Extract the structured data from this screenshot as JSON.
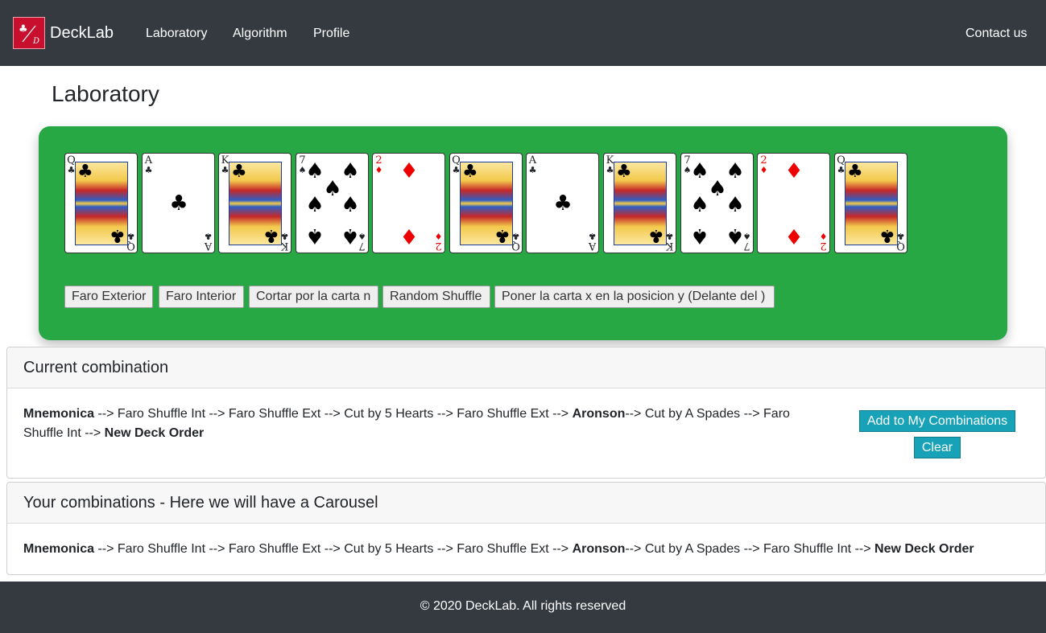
{
  "nav": {
    "brand": "DeckLab",
    "links": [
      "Laboratory",
      "Algorithm",
      "Profile"
    ],
    "contact": "Contact us"
  },
  "page": {
    "title": "Laboratory"
  },
  "cards": [
    {
      "rank": "Q",
      "suit": "♣",
      "color": "black",
      "kind": "face"
    },
    {
      "rank": "A",
      "suit": "♣",
      "color": "black",
      "kind": "ace"
    },
    {
      "rank": "K",
      "suit": "♣",
      "color": "black",
      "kind": "face"
    },
    {
      "rank": "7",
      "suit": "♠",
      "color": "black",
      "kind": "seven"
    },
    {
      "rank": "2",
      "suit": "♦",
      "color": "red",
      "kind": "two"
    },
    {
      "rank": "Q",
      "suit": "♣",
      "color": "black",
      "kind": "face"
    },
    {
      "rank": "A",
      "suit": "♣",
      "color": "black",
      "kind": "ace"
    },
    {
      "rank": "K",
      "suit": "♣",
      "color": "black",
      "kind": "face"
    },
    {
      "rank": "7",
      "suit": "♠",
      "color": "black",
      "kind": "seven"
    },
    {
      "rank": "2",
      "suit": "♦",
      "color": "red",
      "kind": "two"
    },
    {
      "rank": "Q",
      "suit": "♣",
      "color": "black",
      "kind": "face"
    }
  ],
  "operations": [
    "Faro Exterior",
    "Faro Interior",
    "Cortar por la carta n",
    "Random Shuffle",
    "Poner la carta x en la posicion y (Delante del )"
  ],
  "current": {
    "header": "Current combination",
    "start": "Mnemonica",
    "steps_a": " --> Faro Shuffle Int --> Faro Shuffle Ext --> Cut by 5 Hearts --> Faro Shuffle Ext --> ",
    "middle": "Aronson",
    "steps_b": "--> Cut by A Spades --> Faro Shuffle Int --> ",
    "end": "New Deck Order",
    "add_button": "Add to My Combinations",
    "clear_button": "Clear"
  },
  "saved": {
    "header": "Your combinations - Here we will have a Carousel",
    "start": "Mnemonica",
    "steps_a": " --> Faro Shuffle Int --> Faro Shuffle Ext --> Cut by 5 Hearts --> Faro Shuffle Ext --> ",
    "middle": "Aronson",
    "steps_b": "--> Cut by A Spades --> Faro Shuffle Int --> ",
    "end": "New Deck Order"
  },
  "footer": {
    "text": "© 2020 DeckLab. All rights reserved"
  },
  "colors": {
    "navbar": "#343a40",
    "lab_panel": "#28a745",
    "info_button": "#17a2b8",
    "red_suit": "#e00000"
  }
}
